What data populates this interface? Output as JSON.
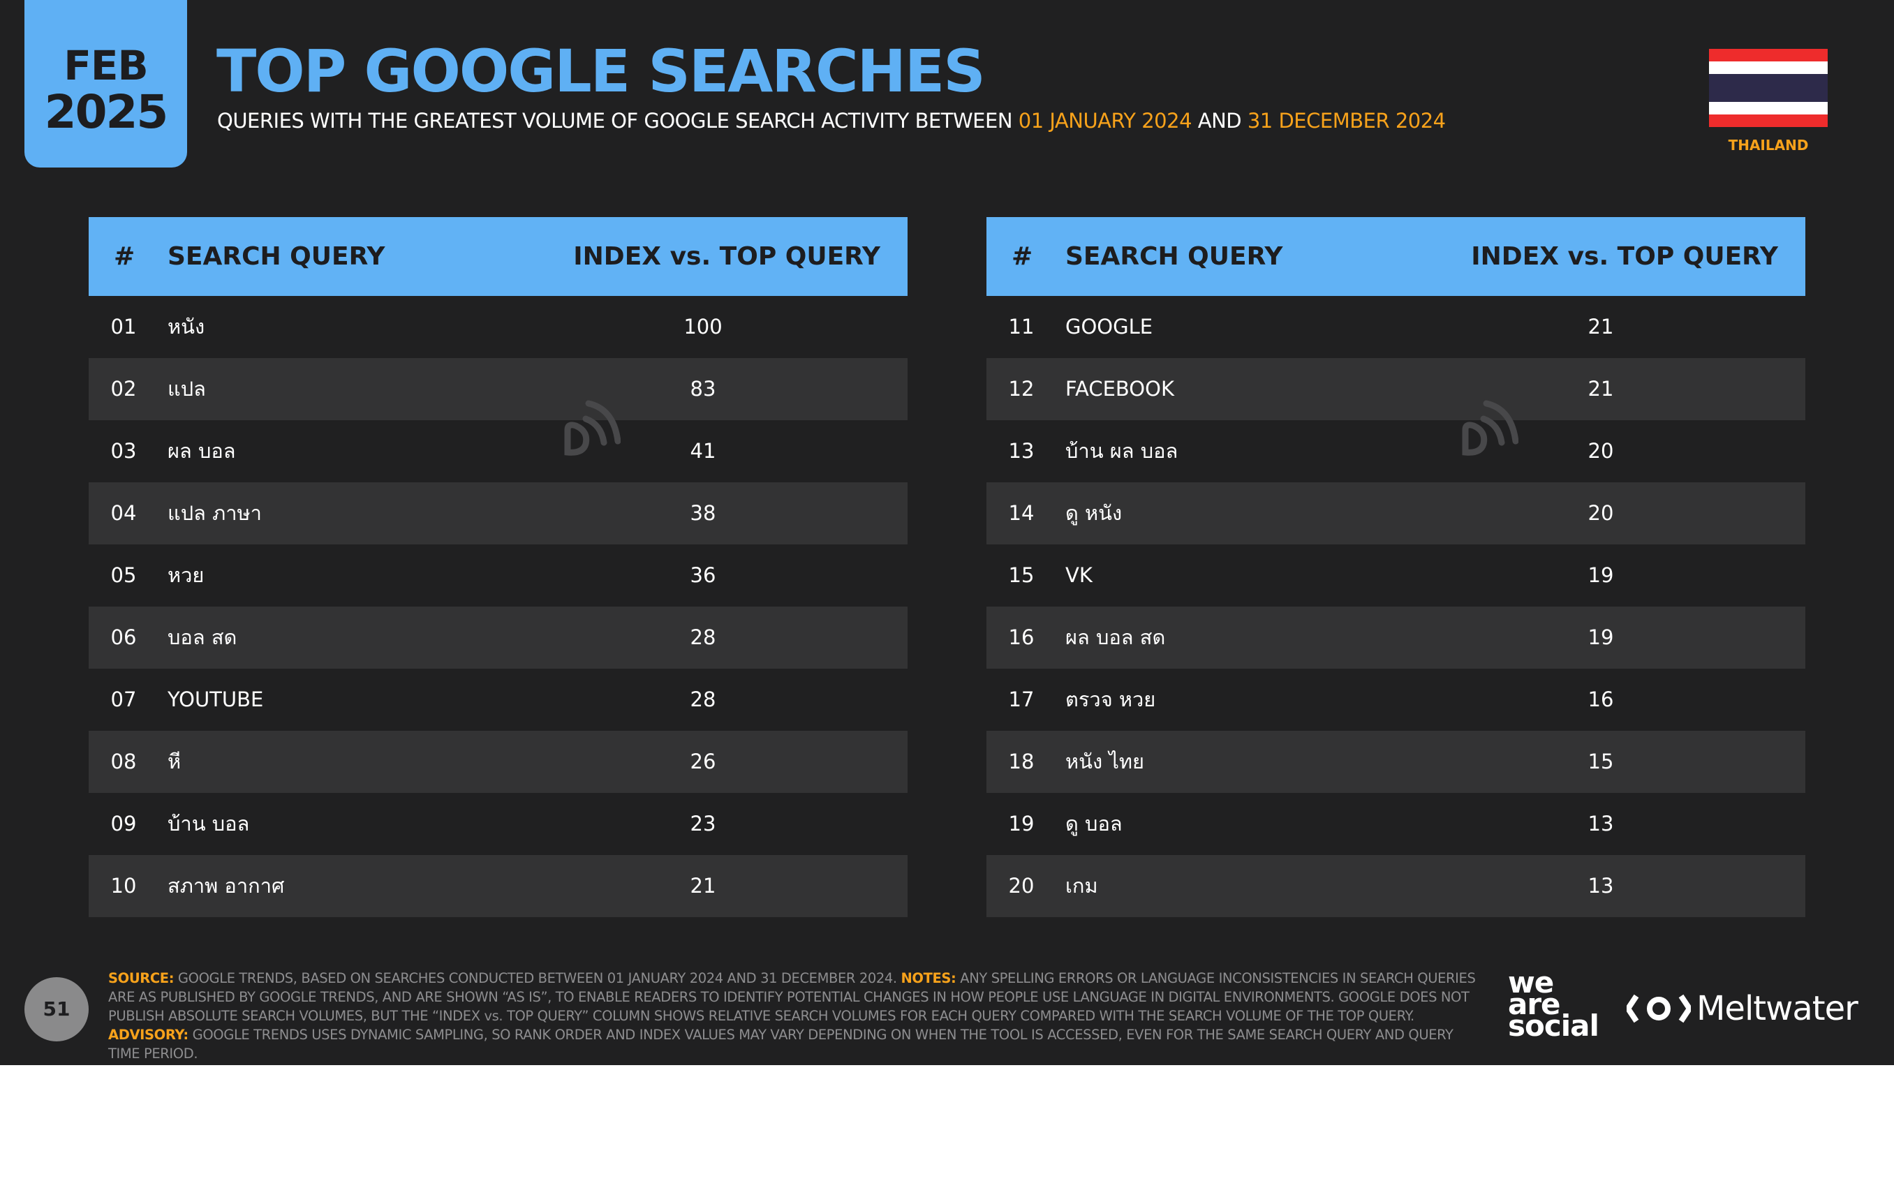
{
  "date_badge": {
    "month": "FEB",
    "year": "2025"
  },
  "header": {
    "title": "TOP GOOGLE SEARCHES",
    "subtitle_prefix": "QUERIES WITH THE GREATEST VOLUME OF GOOGLE SEARCH ACTIVITY BETWEEN",
    "date_start": "01 JANUARY 2024",
    "subtitle_and": "AND",
    "date_end": "31 DECEMBER 2024"
  },
  "country": {
    "label": "THAILAND",
    "flag_colors": [
      "#ee2c2c",
      "#ffffff",
      "#2d2a4a",
      "#ffffff",
      "#ee2c2c"
    ]
  },
  "columns": {
    "rank": "#",
    "query": "SEARCH QUERY",
    "index": "INDEX vs. TOP QUERY"
  },
  "rows": [
    {
      "rank": "01",
      "query": "หนัง",
      "index": "100"
    },
    {
      "rank": "02",
      "query": "แปล",
      "index": "83"
    },
    {
      "rank": "03",
      "query": "ผล บอล",
      "index": "41"
    },
    {
      "rank": "04",
      "query": "แปล ภาษา",
      "index": "38"
    },
    {
      "rank": "05",
      "query": "หวย",
      "index": "36"
    },
    {
      "rank": "06",
      "query": "บอล สด",
      "index": "28"
    },
    {
      "rank": "07",
      "query": "YOUTUBE",
      "index": "28"
    },
    {
      "rank": "08",
      "query": "หี",
      "index": "26"
    },
    {
      "rank": "09",
      "query": "บ้าน บอล",
      "index": "23"
    },
    {
      "rank": "10",
      "query": "สภาพ อากาศ",
      "index": "21"
    },
    {
      "rank": "11",
      "query": "GOOGLE",
      "index": "21"
    },
    {
      "rank": "12",
      "query": "FACEBOOK",
      "index": "21"
    },
    {
      "rank": "13",
      "query": "บ้าน ผล บอล",
      "index": "20"
    },
    {
      "rank": "14",
      "query": "ดู หนัง",
      "index": "20"
    },
    {
      "rank": "15",
      "query": "VK",
      "index": "19"
    },
    {
      "rank": "16",
      "query": "ผล บอล สด",
      "index": "19"
    },
    {
      "rank": "17",
      "query": "ตรวจ หวย",
      "index": "16"
    },
    {
      "rank": "18",
      "query": "หนัง ไทย",
      "index": "15"
    },
    {
      "rank": "19",
      "query": "ดู บอล",
      "index": "13"
    },
    {
      "rank": "20",
      "query": "เกม",
      "index": "13"
    }
  ],
  "footer": {
    "page_number": "51",
    "source_label": "SOURCE:",
    "source_text": "GOOGLE TRENDS, BASED ON SEARCHES CONDUCTED BETWEEN 01 JANUARY 2024 AND 31 DECEMBER 2024.",
    "notes_label": "NOTES:",
    "notes_text": "ANY SPELLING ERRORS OR LANGUAGE INCONSISTENCIES IN SEARCH QUERIES ARE AS PUBLISHED BY GOOGLE TRENDS, AND ARE SHOWN “AS IS”, TO ENABLE READERS TO IDENTIFY POTENTIAL CHANGES IN HOW PEOPLE USE LANGUAGE IN DIGITAL ENVIRONMENTS. GOOGLE DOES NOT PUBLISH ABSOLUTE SEARCH VOLUMES, BUT THE “INDEX vs. TOP QUERY” COLUMN SHOWS RELATIVE SEARCH VOLUMES FOR EACH QUERY COMPARED WITH THE SEARCH VOLUME OF THE TOP QUERY.",
    "advisory_label": "ADVISORY:",
    "advisory_text": "GOOGLE TRENDS USES DYNAMIC SAMPLING, SO RANK ORDER AND INDEX VALUES MAY VARY DEPENDING ON WHEN THE TOOL IS ACCESSED, EVEN FOR THE SAME SEARCH QUERY AND QUERY TIME PERIOD."
  },
  "logos": {
    "we_are_social": [
      "we",
      "are",
      "social"
    ],
    "meltwater": "Meltwater"
  },
  "icons": {
    "watermark": "datareportal-watermark-icon",
    "meltwater": "meltwater-logo-icon"
  }
}
